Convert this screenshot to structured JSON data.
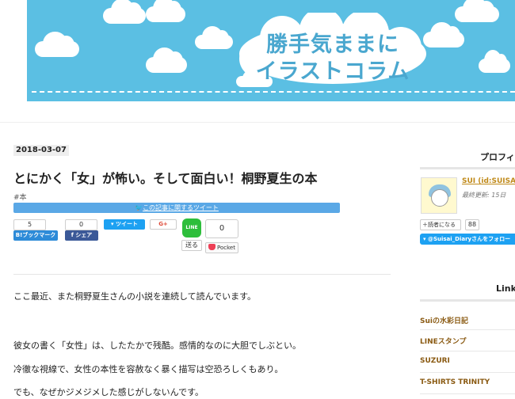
{
  "header": {
    "title_line1": "勝手気ままに",
    "title_line2": "イラストコラム",
    "bg_color": "#5bbfe3"
  },
  "article": {
    "date": "2018-03-07",
    "title": "とにかく「女」が怖い。そして面白い！桐野夏生の本",
    "tag": "#本",
    "tweet_bar_label": "この記事に関するツイート",
    "share": {
      "hatena_count": "5",
      "hatena_label": "B!ブックマーク",
      "facebook_count": "0",
      "facebook_label": "シェア",
      "twitter_label": "ツイート",
      "gplus_label": "G+",
      "line_icon": "LINE",
      "line_label": "送る",
      "pocket_count": "0",
      "pocket_label": "Pocket"
    },
    "paragraphs": [
      "ここ最近、また桐野夏生さんの小説を連続して読んでいます。",
      "彼女の書く「女性」は、したたかで残酷。感情的なのに大胆でしぶとい。",
      "冷徹な視線で、女性の本性を容赦なく暴く描写は空恐ろしくもあり。",
      "でも、なぜかジメジメした感じがしないんです。"
    ]
  },
  "sidebar": {
    "profile_heading": "プロフィ",
    "user_name": "SUI (id:SUISA",
    "updated": "最終更新: 15日",
    "reader_button": "読者になる",
    "reader_count": "88",
    "follow_button": "@Suisai_Diaryさんをフォロー",
    "links_heading": "Link",
    "links": [
      "Suiの水彩日記",
      "LINEスタンプ",
      "SUZURI",
      "T-SHIRTS TRINITY"
    ]
  },
  "colors": {
    "accent_blue": "#5aa8e6",
    "link_gold": "#8a5a12",
    "line_green": "#2dbe3b",
    "pocket_red": "#ee4056"
  }
}
